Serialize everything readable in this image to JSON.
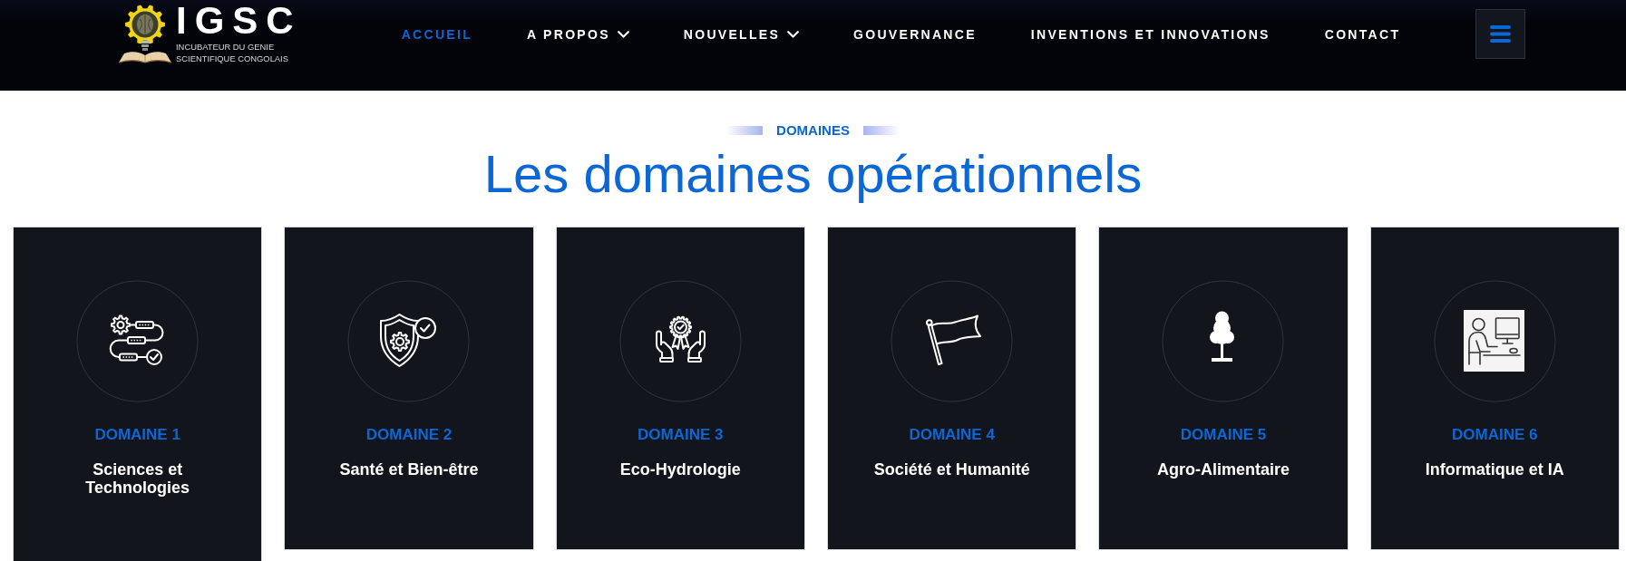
{
  "header": {
    "logo": {
      "title": "IGSC",
      "subtitle": [
        "INCUBATEUR DU GENIE",
        "SCIENTIFIQUE CONGOLAIS"
      ]
    },
    "nav": [
      {
        "label": "ACCUEIL",
        "kind": "link",
        "selected": true
      },
      {
        "label": "A PROPOS",
        "kind": "dropdown",
        "selected": false
      },
      {
        "label": "NOUVELLES",
        "kind": "dropdown",
        "selected": false
      },
      {
        "label": "GOUVERNANCE",
        "kind": "link",
        "selected": false
      },
      {
        "label": "INVENTIONS ET INNOVATIONS",
        "kind": "link",
        "selected": false
      },
      {
        "label": "CONTACT",
        "kind": "link",
        "selected": false
      }
    ]
  },
  "section": {
    "overline": "DOMAINES",
    "title": "Les domaines opérationnels"
  },
  "domains": [
    {
      "label": "DOMAINE 1",
      "title": "Sciences et Technologies"
    },
    {
      "label": "DOMAINE 2",
      "title": "Santé et Bien-être"
    },
    {
      "label": "DOMAINE 3",
      "title": "Eco-Hydrologie"
    },
    {
      "label": "DOMAINE 4",
      "title": "Société et Humanité"
    },
    {
      "label": "DOMAINE 5",
      "title": "Agro-Alimentaire"
    },
    {
      "label": "DOMAINE 6",
      "title": "Informatique et IA"
    }
  ]
}
